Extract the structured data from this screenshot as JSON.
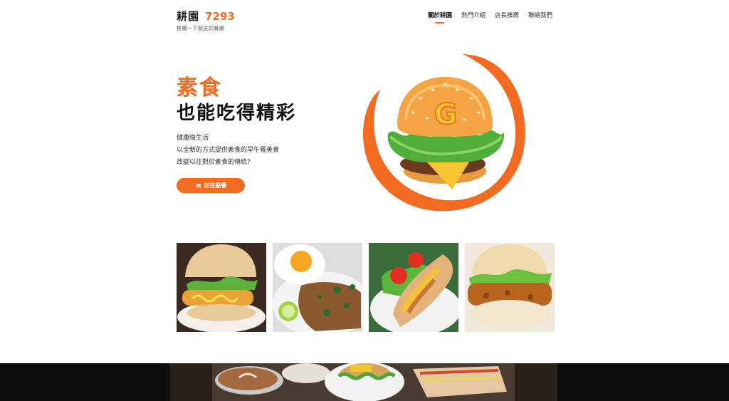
{
  "header": {
    "logo_name": "耕園",
    "logo_number": "7293",
    "logo_tagline": "推薦一下朋友的餐廳"
  },
  "nav": {
    "items": [
      {
        "label": "關於耕園",
        "active": true
      },
      {
        "label": "熱門介紹",
        "active": false
      },
      {
        "label": "店長推薦",
        "active": false
      },
      {
        "label": "聯絡我們",
        "active": false
      }
    ]
  },
  "hero": {
    "title_accent": "素食",
    "title_main": "也能吃得精彩",
    "lines": [
      "健康綠生活",
      "以全新的方式提供素食的早午餐美食",
      "改變以往對於素食的傳統?"
    ],
    "cta_label": "前往點餐",
    "cta_icon": "cart-icon",
    "art_letter": "G"
  },
  "colors": {
    "accent": "#f26b21",
    "text": "#222222",
    "strip_bg": "#0d0d0d"
  }
}
